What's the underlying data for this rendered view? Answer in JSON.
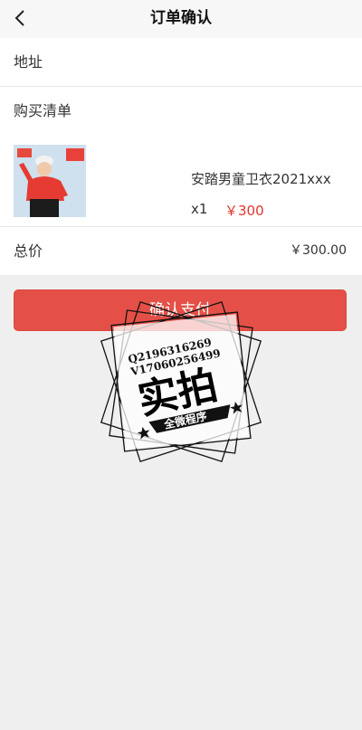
{
  "header": {
    "title": "订单确认"
  },
  "sections": {
    "address_label": "地址",
    "list_label": "购买清单"
  },
  "product": {
    "name": "安踏男童卫衣2021xxx",
    "quantity": "x1",
    "price": "￥300",
    "image_icon": "product-photo"
  },
  "summary": {
    "total_label": "总价",
    "total_amount": "￥300.00"
  },
  "actions": {
    "pay_label": "确认支付"
  },
  "watermark": {
    "qq": "Q2196316269",
    "v": "V17060256499",
    "main": "实拍",
    "ribbon": "全微程序"
  },
  "colors": {
    "accent": "#e45047",
    "price": "#e0342f"
  }
}
